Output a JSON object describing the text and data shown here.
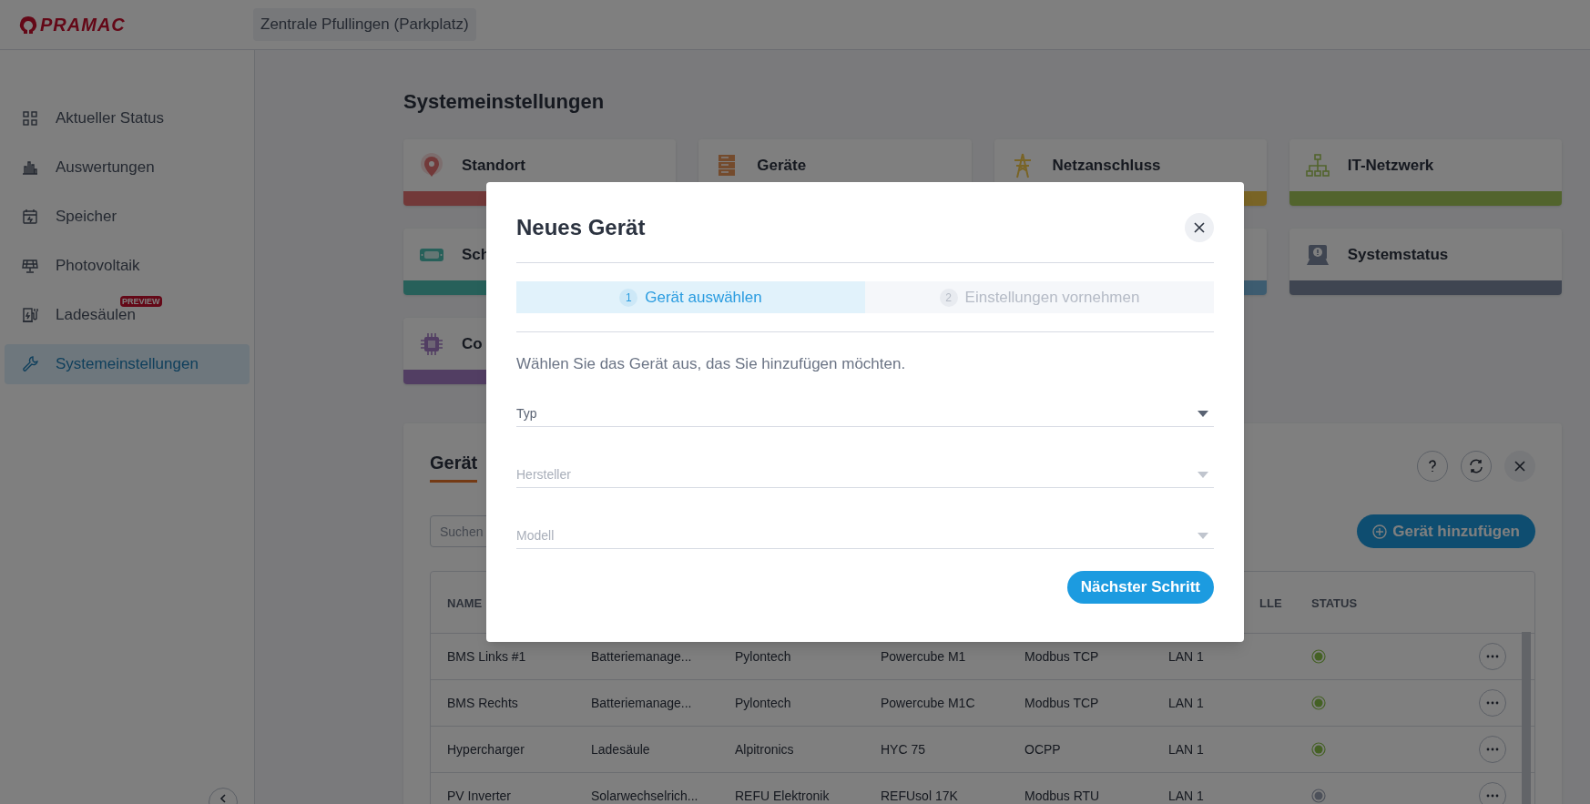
{
  "header": {
    "logo": "PRAMAC",
    "location": "Zentrale Pfullingen (Parkplatz)"
  },
  "sidebar": {
    "items": [
      {
        "label": "Aktueller Status",
        "selected": false
      },
      {
        "label": "Auswertungen",
        "selected": false
      },
      {
        "label": "Speicher",
        "selected": false
      },
      {
        "label": "Photovoltaik",
        "selected": false
      },
      {
        "label": "Ladesäulen",
        "selected": false,
        "badge": "PREVIEW"
      },
      {
        "label": "Systemeinstellungen",
        "selected": true
      }
    ]
  },
  "page": {
    "title": "Systemeinstellungen",
    "tiles": [
      {
        "title": "Standort",
        "color": "#723939"
      },
      {
        "title": "Geräte"
      },
      {
        "title": "Netzanschluss",
        "color": "#796426"
      },
      {
        "title": "IT-Netzwerk",
        "color": "#52642d"
      },
      {
        "title": "Sch",
        "color": "#27605a"
      },
      {
        "color": "#3d5c70"
      },
      {
        "title": "Systemstatus",
        "color": "#3f4551"
      },
      {
        "title": "Co",
        "color": "#523e63"
      }
    ]
  },
  "devices_panel": {
    "tab": "Gerät",
    "search": {
      "placeholder": "Suchen"
    },
    "add_button": "Gerät hinzufügen",
    "columns": [
      "NAME",
      "",
      "",
      "",
      "",
      "LLE",
      "STATUS"
    ],
    "rows": [
      {
        "cells": [
          "BMS Links #1",
          "Batteriemanage...",
          "Pylontech",
          "Powercube M1",
          "Modbus TCP",
          "LAN 1"
        ],
        "color": "#456125"
      },
      {
        "cells": [
          "BMS Rechts",
          "Batteriemanage...",
          "Pylontech",
          "Powercube M1C",
          "Modbus TCP",
          "LAN 1"
        ],
        "color": "#456125"
      },
      {
        "cells": [
          "Hypercharger",
          "Ladesäule",
          "Alpitronics",
          "HYC 75",
          "OCPP",
          "LAN 1"
        ],
        "color": "#456125"
      },
      {
        "cells": [
          "PV Inverter",
          "Solarwechselrich...",
          "REFU Elektronik",
          "REFUsol 17K",
          "Modbus RTU",
          "LAN 1"
        ],
        "color": "#4d515a"
      }
    ]
  },
  "dialog": {
    "title": "Neues Gerät",
    "steps": [
      {
        "number": "1",
        "label": "Gerät auswählen",
        "selected": true
      },
      {
        "number": "2",
        "label": "Einstellungen vornehmen",
        "selected": false
      }
    ],
    "intro": "Wählen Sie das Gerät aus, das Sie hinzufügen möchten.",
    "fields": [
      {
        "placeholder": "Typ",
        "disabled": false
      },
      {
        "placeholder": "Hersteller",
        "disabled": true
      },
      {
        "placeholder": "Modell",
        "disabled": true
      }
    ],
    "next_button": "Nächster Schritt"
  }
}
